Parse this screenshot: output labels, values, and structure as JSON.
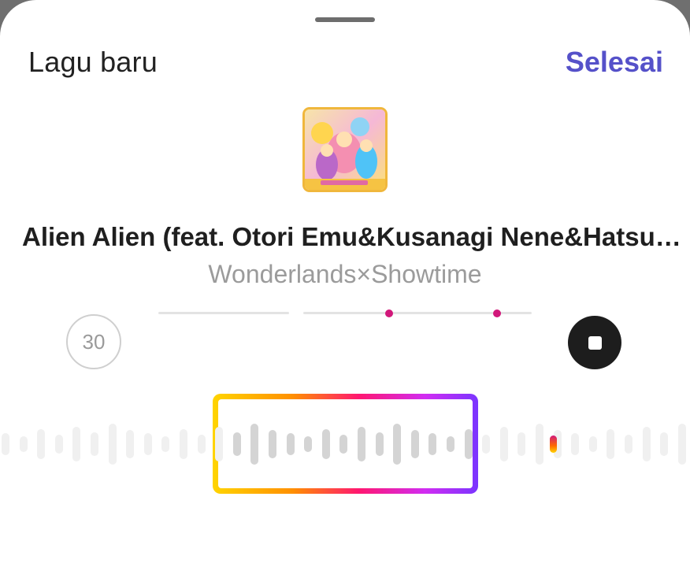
{
  "header": {
    "title": "Lagu baru",
    "done_label": "Selesai"
  },
  "track": {
    "title": "Alien Alien (feat. Otori Emu&Kusanagi Nene&Hatsu…",
    "artist": "Wonderlands×Showtime",
    "cover_icon": "album-art"
  },
  "controls": {
    "duration_label": "30",
    "stop_icon": "stop-icon"
  },
  "colors": {
    "accent": "#5551c9",
    "marker": "#d1177a",
    "selector_gradient": [
      "#ffd400",
      "#ff9000",
      "#ff1770",
      "#d12cf2",
      "#7a35ff"
    ]
  }
}
